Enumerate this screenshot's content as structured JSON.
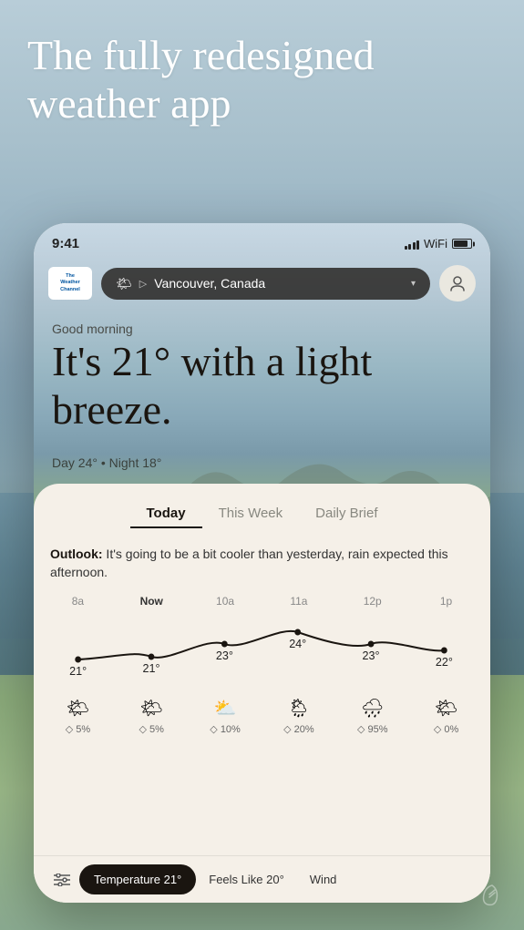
{
  "hero": {
    "title": "The fully redesigned weather app"
  },
  "status_bar": {
    "time": "9:41"
  },
  "header": {
    "logo_line1": "The",
    "logo_line2": "Weather",
    "logo_line3": "Channel",
    "location": "Vancouver, Canada",
    "location_icon": "▽",
    "profile_icon": "👤"
  },
  "weather": {
    "greeting": "Good morning",
    "description": "It's 21° with a light breeze.",
    "day_temp": "Day 24°",
    "night_temp": "Night 18°"
  },
  "tabs": [
    {
      "label": "Today",
      "active": true
    },
    {
      "label": "This Week",
      "active": false
    },
    {
      "label": "Daily Brief",
      "active": false
    }
  ],
  "outlook": {
    "bold": "Outlook:",
    "text": " It's going to be a bit cooler than yesterday, rain expected this afternoon."
  },
  "hourly": {
    "times": [
      "8a",
      "Now",
      "10a",
      "11a",
      "12p",
      "1p"
    ],
    "temps": [
      "21°",
      "21°",
      "23°",
      "24°",
      "23°",
      "22°"
    ],
    "icons": [
      "🌤",
      "🌤",
      "⛅",
      "🌦",
      "🌧",
      "🌤"
    ],
    "precip": [
      "◇ 5%",
      "◇ 5%",
      "◇ 10%",
      "◇ 20%",
      "◇ 95%",
      "◇ 0%"
    ]
  },
  "filter_bar": {
    "filter_icon": "⊟",
    "chip1": "Temperature 21°",
    "chip2": "Feels Like 20°",
    "chip3": "Wind"
  },
  "colors": {
    "accent_dark": "#1a1510",
    "tab_active": "#1a1510",
    "tab_inactive": "#888880",
    "background_card": "#f5f0e8"
  }
}
